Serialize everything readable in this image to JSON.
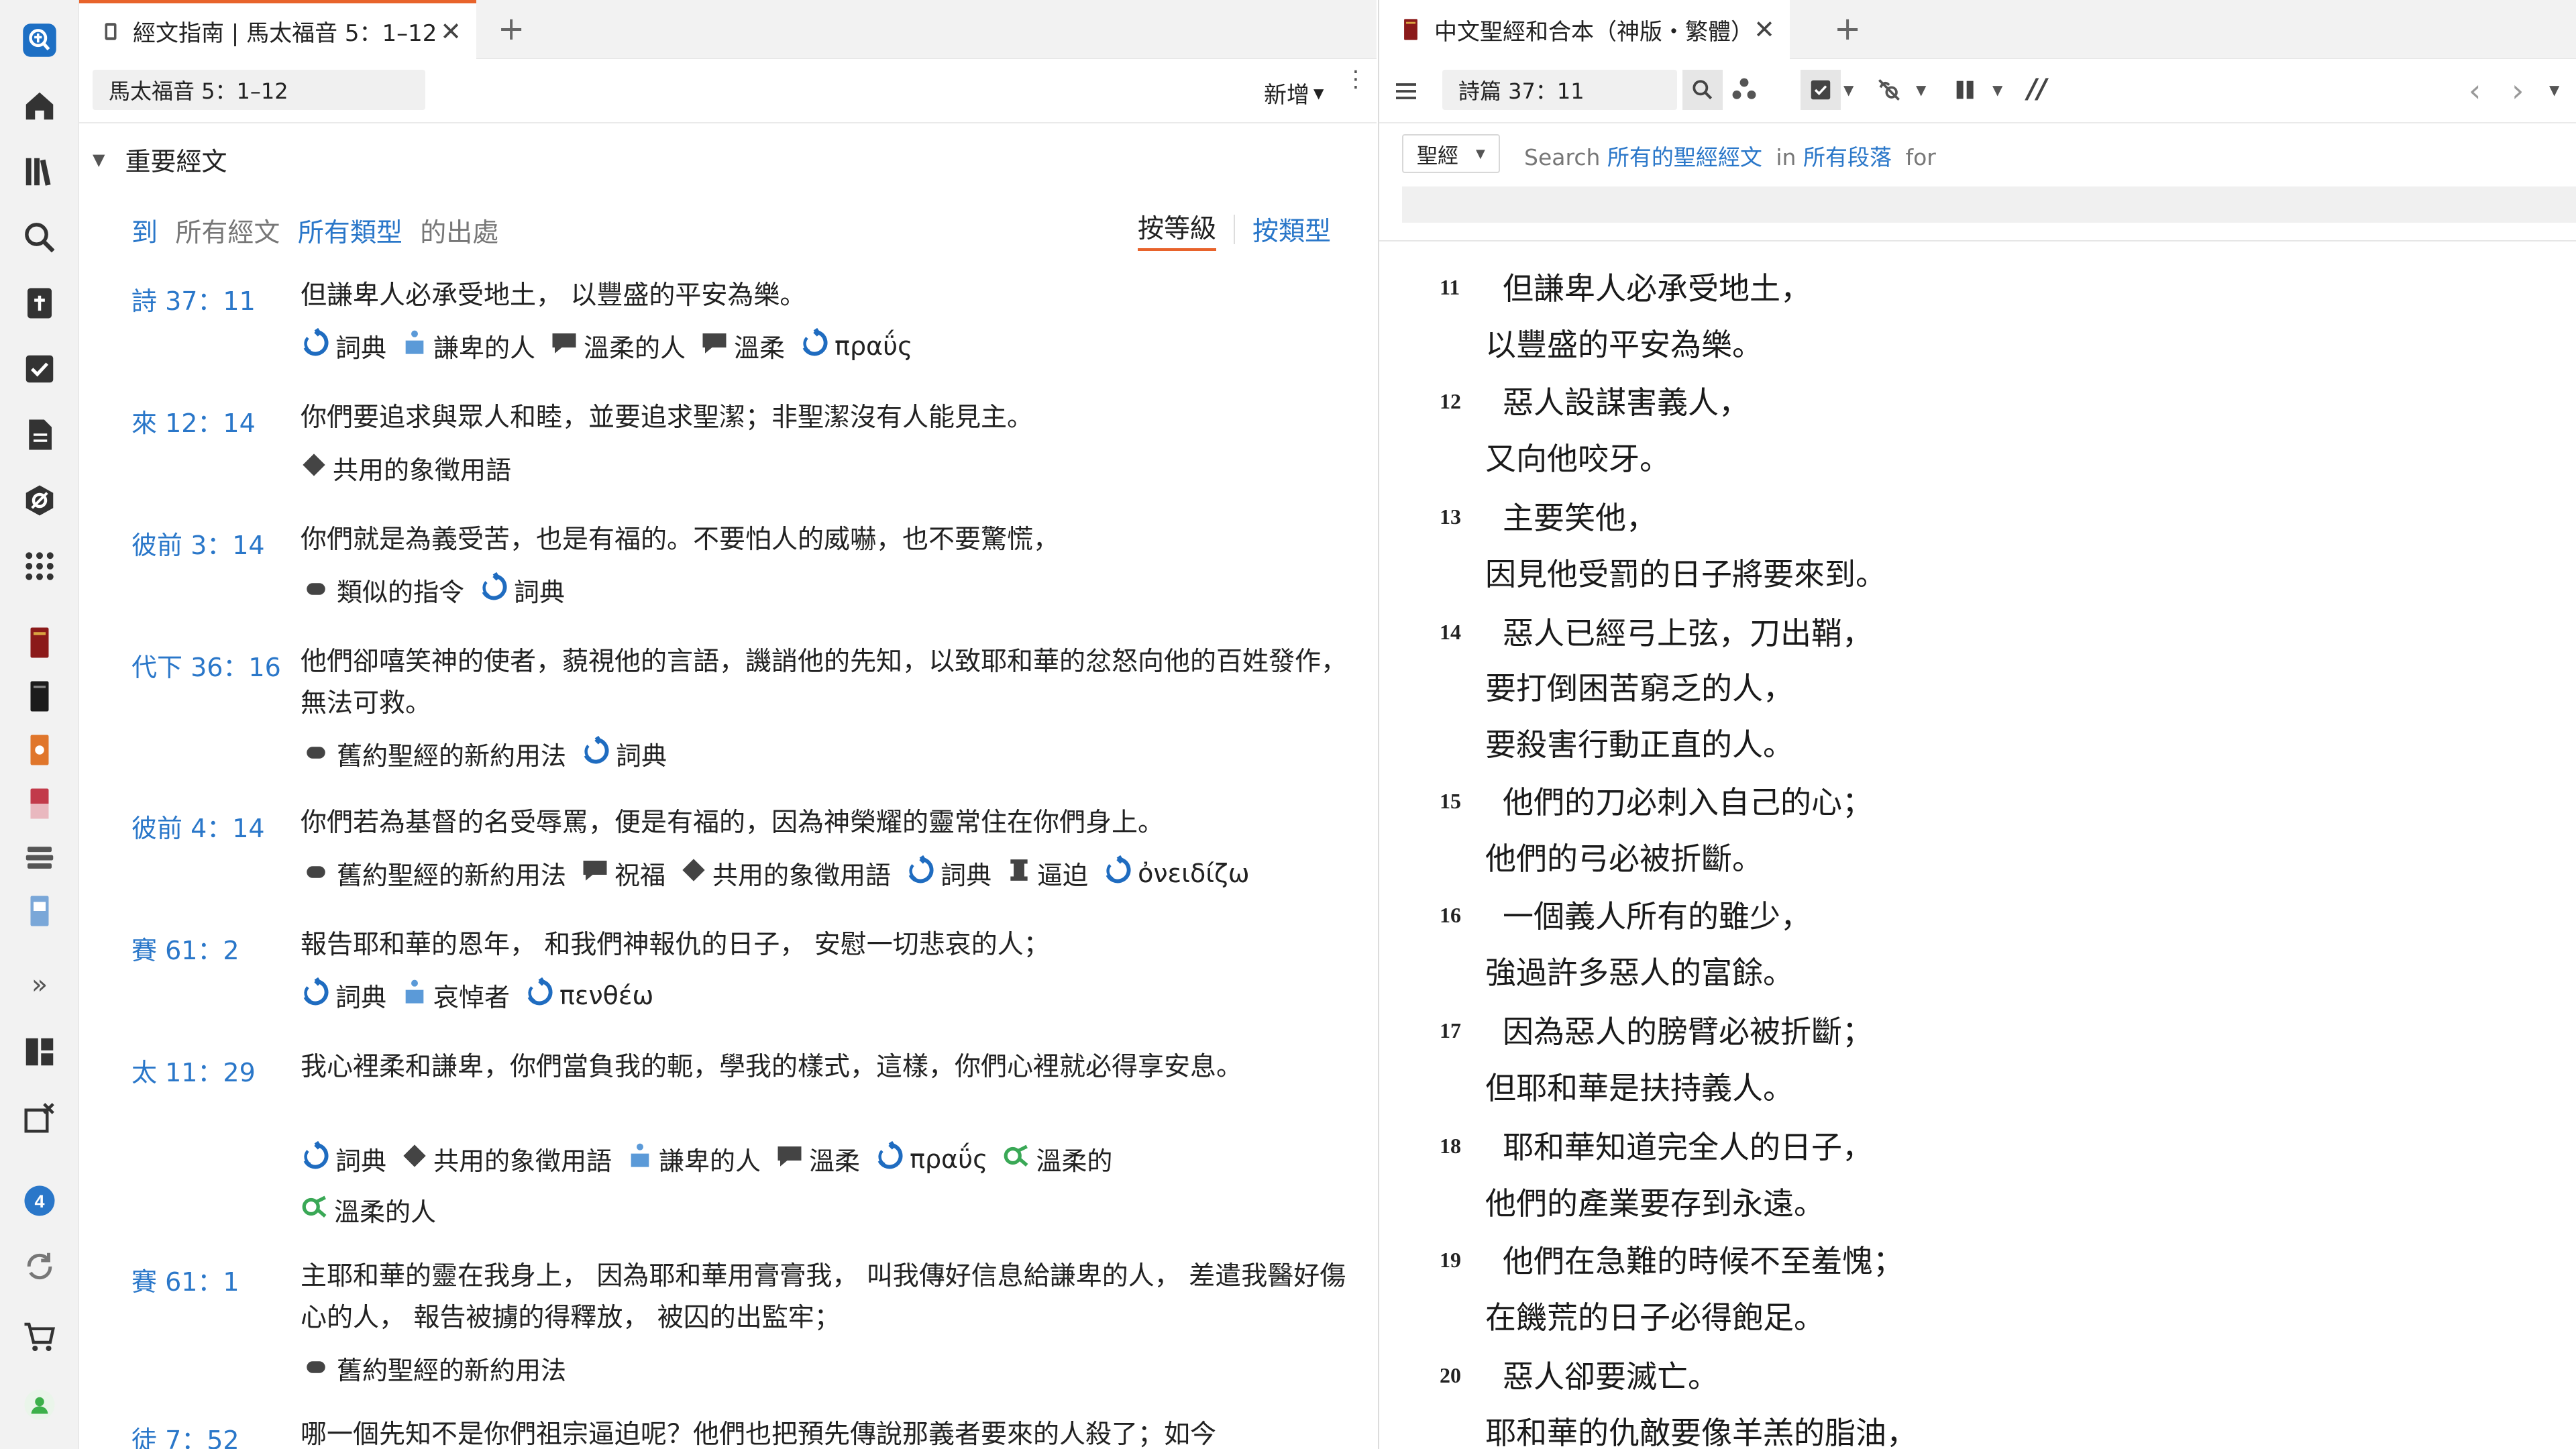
{
  "colors": {
    "accent": "#2a77c9",
    "tab_active_top": "#e8632b"
  },
  "sidebar": {
    "icons": [
      "search-app-icon",
      "home-icon",
      "library-icon",
      "search-icon",
      "bible-add-icon",
      "checklist-icon",
      "document-icon",
      "eye-settings-icon",
      "apps-icon",
      "book-red-icon",
      "book-black-icon",
      "book-orange-icon",
      "book-pink-icon",
      "stack-icon",
      "book-blue-icon",
      "expand-icon",
      "layout-icon",
      "close-layout-icon",
      "notification-icon",
      "sync-icon",
      "cart-icon",
      "user-icon"
    ],
    "expand_label": "»",
    "notification_count": "4"
  },
  "left": {
    "tab_title": "經文指南 | 馬太福音 5：1–12",
    "tab_close": "✕",
    "tab_add": "+",
    "reference": "馬太福音 5：1–12",
    "add_menu": "新增",
    "section_title": "重要經文",
    "filter": {
      "to": "到",
      "all_verses": "所有經文",
      "all_types": "所有類型",
      "occurrences": "的出處",
      "by_rank": "按等級",
      "by_type": "按類型"
    },
    "entries": [
      {
        "ref": "詩 37：11",
        "text": "但謙卑人必承受地土， 以豐盛的平安為樂。",
        "tags": [
          [
            "詞典",
            "cycle"
          ],
          [
            "謙卑的人",
            "person"
          ],
          [
            "溫柔的人",
            "speech"
          ],
          [
            "溫柔",
            "speech"
          ],
          [
            "πραΰς",
            "cycle"
          ]
        ]
      },
      {
        "ref": "來 12：14",
        "text": "你們要追求與眾人和睦，並要追求聖潔；非聖潔沒有人能見主。",
        "tags": [
          [
            "共用的象徵用語",
            "diamond"
          ]
        ]
      },
      {
        "ref": "彼前 3：14",
        "text": "你們就是為義受苦，也是有福的。不要怕人的威嚇，也不要驚慌，",
        "tags": [
          [
            "類似的指令",
            "pill"
          ],
          [
            "詞典",
            "cycle"
          ]
        ]
      },
      {
        "ref": "代下 36：16",
        "text": "他們卻嘻笑神的使者，藐視他的言語，譏誚他的先知，以致耶和華的忿怒向他的百姓發作，無法可救。",
        "tags": [
          [
            "舊約聖經的新約用法",
            "pill"
          ],
          [
            "詞典",
            "cycle"
          ]
        ]
      },
      {
        "ref": "彼前 4：14",
        "text": "你們若為基督的名受辱罵，便是有福的，因為神榮耀的靈常住在你們身上。",
        "tags": [
          [
            "舊約聖經的新約用法",
            "pill"
          ],
          [
            "祝福",
            "speech"
          ],
          [
            "共用的象徵用語",
            "diamond"
          ],
          [
            "詞典",
            "cycle"
          ],
          [
            "逼迫",
            "pillar"
          ],
          [
            "ὀνειδίζω",
            "cycle"
          ]
        ]
      },
      {
        "ref": "賽 61：2",
        "text": "報告耶和華的恩年， 和我們神報仇的日子， 安慰一切悲哀的人；",
        "tags": [
          [
            "詞典",
            "cycle"
          ],
          [
            "哀悼者",
            "person"
          ],
          [
            "πενθέω",
            "cycle"
          ]
        ]
      },
      {
        "ref": "太 11：29",
        "text": "我心裡柔和謙卑，你們當負我的軛，學我的樣式，這樣，你們心裡就必得享安息。",
        "tags": [
          [
            "詞典",
            "cycle"
          ],
          [
            "共用的象徵用語",
            "diamond"
          ],
          [
            "謙卑的人",
            "person"
          ],
          [
            "溫柔",
            "speech"
          ],
          [
            "πραΰς",
            "cycle"
          ],
          [
            "溫柔的",
            "green"
          ]
        ],
        "tags2": [
          [
            "溫柔的人",
            "green"
          ]
        ]
      },
      {
        "ref": "賽 61：1",
        "text": "主耶和華的靈在我身上， 因為耶和華用膏膏我， 叫我傳好信息給謙卑的人， 差遣我醫好傷心的人， 報告被擄的得釋放， 被囚的出監牢；",
        "tags": [
          [
            "舊約聖經的新約用法",
            "pill"
          ]
        ]
      },
      {
        "ref": "徒 7：52",
        "text": "哪一個先知不是你們祖宗逼迫呢？他們也把預先傳說那義者要來的人殺了；如今",
        "tags": []
      }
    ]
  },
  "right": {
    "tab_title": "中文聖經和合本（神版・繁體）",
    "tab_close": "✕",
    "tab_add": "+",
    "reference": "詩篇 37：11",
    "search": {
      "scope_button": "聖經",
      "label_search": "Search",
      "scope_link": "所有的聖經經文",
      "label_in": "in",
      "range_link": "所有段落",
      "label_for": "for"
    },
    "verses": [
      {
        "num": "11",
        "lines": [
          "但謙卑人必承受地土，",
          "以豐盛的平安為樂。"
        ]
      },
      {
        "num": "12",
        "lines": [
          "惡人設謀害義人，",
          "又向他咬牙。"
        ]
      },
      {
        "num": "13",
        "lines": [
          "主要笑他，",
          "因見他受罰的日子將要來到。"
        ]
      },
      {
        "num": "14",
        "lines": [
          "惡人已經弓上弦，刀出鞘，",
          "要打倒困苦窮乏的人，",
          "要殺害行動正直的人。"
        ]
      },
      {
        "num": "15",
        "lines": [
          "他們的刀必刺入自己的心；",
          "他們的弓必被折斷。"
        ]
      },
      {
        "num": "16",
        "lines": [
          "一個義人所有的雖少，",
          "強過許多惡人的富餘。"
        ]
      },
      {
        "num": "17",
        "lines": [
          "因為惡人的膀臂必被折斷；",
          "但耶和華是扶持義人。"
        ]
      },
      {
        "num": "18",
        "lines": [
          "耶和華知道完全人的日子，",
          "他們的產業要存到永遠。"
        ]
      },
      {
        "num": "19",
        "lines": [
          "他們在急難的時候不至羞愧；",
          "在饑荒的日子必得飽足。"
        ]
      },
      {
        "num": "20",
        "lines": [
          "惡人卻要滅亡。",
          "耶和華的仇敵要像羊羔的脂油，"
        ]
      }
    ]
  }
}
